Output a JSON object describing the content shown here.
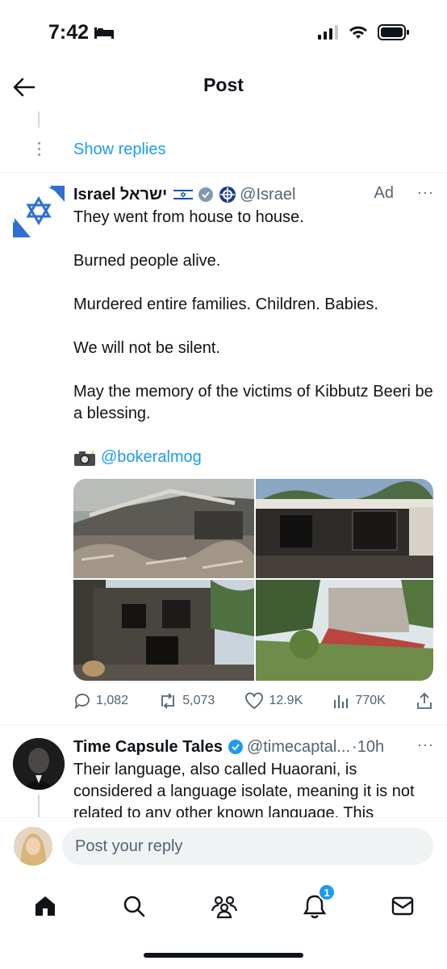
{
  "status_bar": {
    "time": "7:42"
  },
  "nav": {
    "title": "Post"
  },
  "thread": {
    "show_replies": "Show replies"
  },
  "ad_tweet": {
    "name": "Israel ישראל",
    "handle": "@Israel",
    "ad_label": "Ad",
    "more": "···",
    "lines": [
      "They went from house to house.",
      "Burned people alive.",
      "Murdered entire families. Children. Babies.",
      "We will not be silent.",
      "May the memory of the victims of Kibbutz Beeri be a blessing."
    ],
    "credit_mention": "@bokeralmog",
    "stats": {
      "replies": "1,082",
      "reposts": "5,073",
      "likes": "12.9K",
      "views": "770K"
    }
  },
  "tweet2": {
    "name": "Time Capsule Tales",
    "handle": "@timecaptal...",
    "time": "·10h",
    "more": "···",
    "text": "Their language, also called Huaorani, is considered a language isolate, meaning it is not related to any other known language. This"
  },
  "reply": {
    "placeholder": "Post your reply"
  },
  "tabs": {
    "notifications_badge": "1"
  },
  "colors": {
    "accent": "#1d9bf0",
    "text": "#0f1419",
    "secondary": "#536471"
  }
}
